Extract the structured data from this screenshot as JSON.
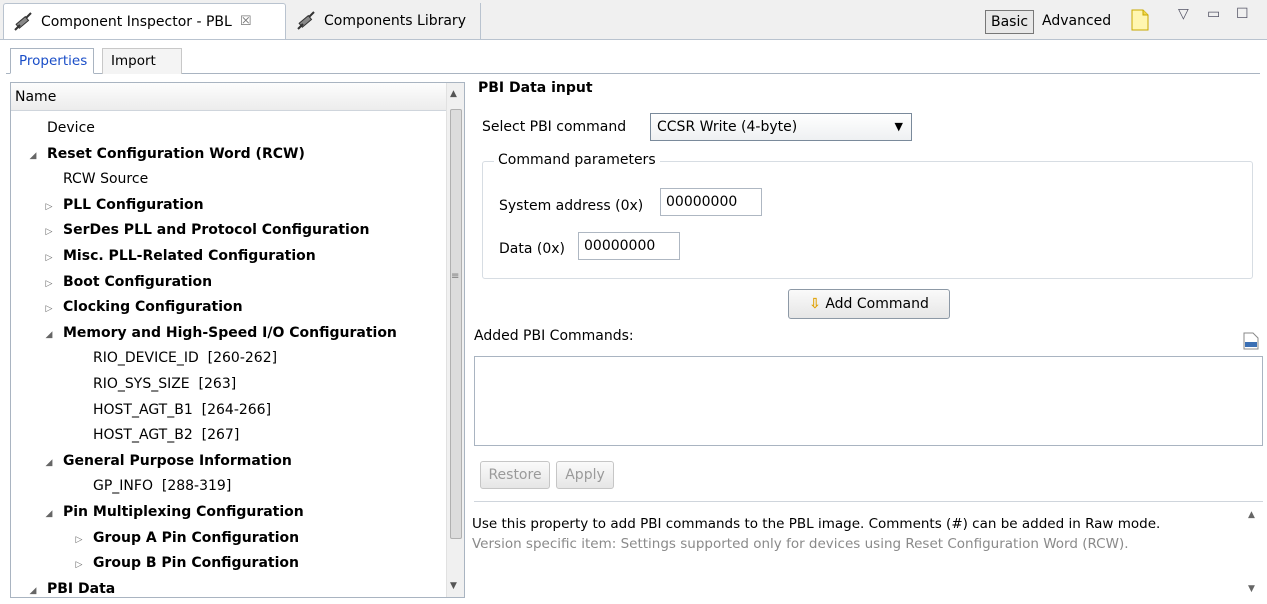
{
  "tabs": {
    "inspector_label": "Component Inspector - PBL",
    "close_glyph": "☒",
    "library_label": "Components Library"
  },
  "view_modes": {
    "basic": "Basic",
    "advanced": "Advanced"
  },
  "window_controls": {
    "menu": "▽",
    "minimize": "▭",
    "maximize": "☐"
  },
  "subtabs": {
    "properties": "Properties",
    "import": "Import"
  },
  "tree": {
    "header": "Name",
    "rows": [
      {
        "label": "Device",
        "bold": false,
        "indent": 1,
        "toggle": ""
      },
      {
        "label": "Reset Configuration Word (RCW)",
        "bold": true,
        "indent": 1,
        "toggle": "expanded"
      },
      {
        "label": "RCW Source",
        "bold": false,
        "indent": 2,
        "toggle": ""
      },
      {
        "label": "PLL Configuration",
        "bold": true,
        "indent": 2,
        "toggle": "collapsed"
      },
      {
        "label": "SerDes PLL and Protocol Configuration",
        "bold": true,
        "indent": 2,
        "toggle": "collapsed"
      },
      {
        "label": "Misc. PLL-Related Configuration",
        "bold": true,
        "indent": 2,
        "toggle": "collapsed"
      },
      {
        "label": "Boot Configuration",
        "bold": true,
        "indent": 2,
        "toggle": "collapsed"
      },
      {
        "label": "Clocking Configuration",
        "bold": true,
        "indent": 2,
        "toggle": "collapsed"
      },
      {
        "label": "Memory and High-Speed I/O Configuration",
        "bold": true,
        "indent": 2,
        "toggle": "expanded"
      },
      {
        "label": "RIO_DEVICE_ID  [260-262]",
        "bold": false,
        "indent": 3,
        "toggle": ""
      },
      {
        "label": "RIO_SYS_SIZE  [263]",
        "bold": false,
        "indent": 3,
        "toggle": ""
      },
      {
        "label": "HOST_AGT_B1  [264-266]",
        "bold": false,
        "indent": 3,
        "toggle": ""
      },
      {
        "label": "HOST_AGT_B2  [267]",
        "bold": false,
        "indent": 3,
        "toggle": ""
      },
      {
        "label": "General Purpose Information",
        "bold": true,
        "indent": 2,
        "toggle": "expanded"
      },
      {
        "label": "GP_INFO  [288-319]",
        "bold": false,
        "indent": 3,
        "toggle": ""
      },
      {
        "label": "Pin Multiplexing Configuration",
        "bold": true,
        "indent": 2,
        "toggle": "expanded"
      },
      {
        "label": "Group A Pin Configuration",
        "bold": true,
        "indent": 3,
        "toggle": "collapsed"
      },
      {
        "label": "Group B Pin Configuration",
        "bold": true,
        "indent": 3,
        "toggle": "collapsed"
      },
      {
        "label": "PBI Data",
        "bold": true,
        "indent": 1,
        "toggle": "expanded"
      }
    ]
  },
  "pbi": {
    "title": "PBI Data input",
    "select_label": "Select PBI command",
    "select_value": "CCSR Write (4-byte)",
    "group_title": "Command parameters",
    "sys_addr_label": "System address (0x)",
    "sys_addr_value": "00000000",
    "data_label": "Data (0x)",
    "data_value": "00000000",
    "add_button": "Add Command",
    "added_label": "Added PBI Commands:",
    "restore_button": "Restore",
    "apply_button": "Apply",
    "help_main": "Use this property to add PBI commands to the PBL image. Comments (#) can be added in Raw mode.",
    "help_sub": "Version specific item: Settings supported only for devices using Reset Configuration Word (RCW)."
  },
  "colors": {
    "accent_tab_text": "#1a4ec8",
    "border": "#a9b4c1"
  },
  "icons": [
    "plug-icon",
    "close-tab-icon",
    "new-note-icon",
    "view-menu-icon",
    "minimize-icon",
    "maximize-icon",
    "expand-triangle-icon",
    "collapse-triangle-icon",
    "add-arrow-icon",
    "binary-file-icon",
    "scroll-up-icon",
    "scroll-down-icon"
  ]
}
